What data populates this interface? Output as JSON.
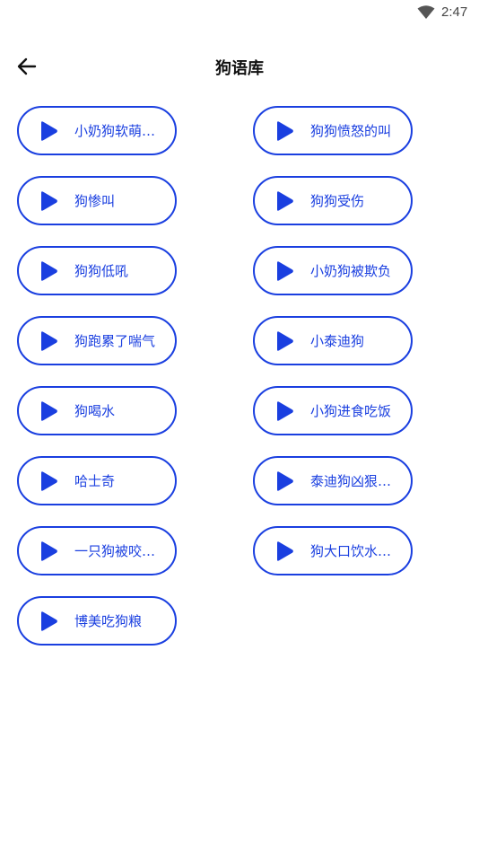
{
  "status_bar": {
    "time": "2:47",
    "wifi_icon": "wifi-icon"
  },
  "app_bar": {
    "back_icon": "arrow-left-icon",
    "title": "狗语库"
  },
  "colors": {
    "accent": "#1a3fe0",
    "background": "#ffffff"
  },
  "sounds": [
    {
      "label": "小奶狗软萌叫..."
    },
    {
      "label": "狗狗愤怒的叫"
    },
    {
      "label": "狗惨叫"
    },
    {
      "label": "狗狗受伤"
    },
    {
      "label": "狗狗低吼"
    },
    {
      "label": "小奶狗被欺负"
    },
    {
      "label": "狗跑累了喘气"
    },
    {
      "label": "小泰迪狗"
    },
    {
      "label": "狗喝水"
    },
    {
      "label": "小狗进食吃饭"
    },
    {
      "label": "哈士奇"
    },
    {
      "label": "泰迪狗凶狠的..."
    },
    {
      "label": "一只狗被咬伤..."
    },
    {
      "label": "狗大口饮水的..."
    },
    {
      "label": "博美吃狗粮"
    }
  ]
}
